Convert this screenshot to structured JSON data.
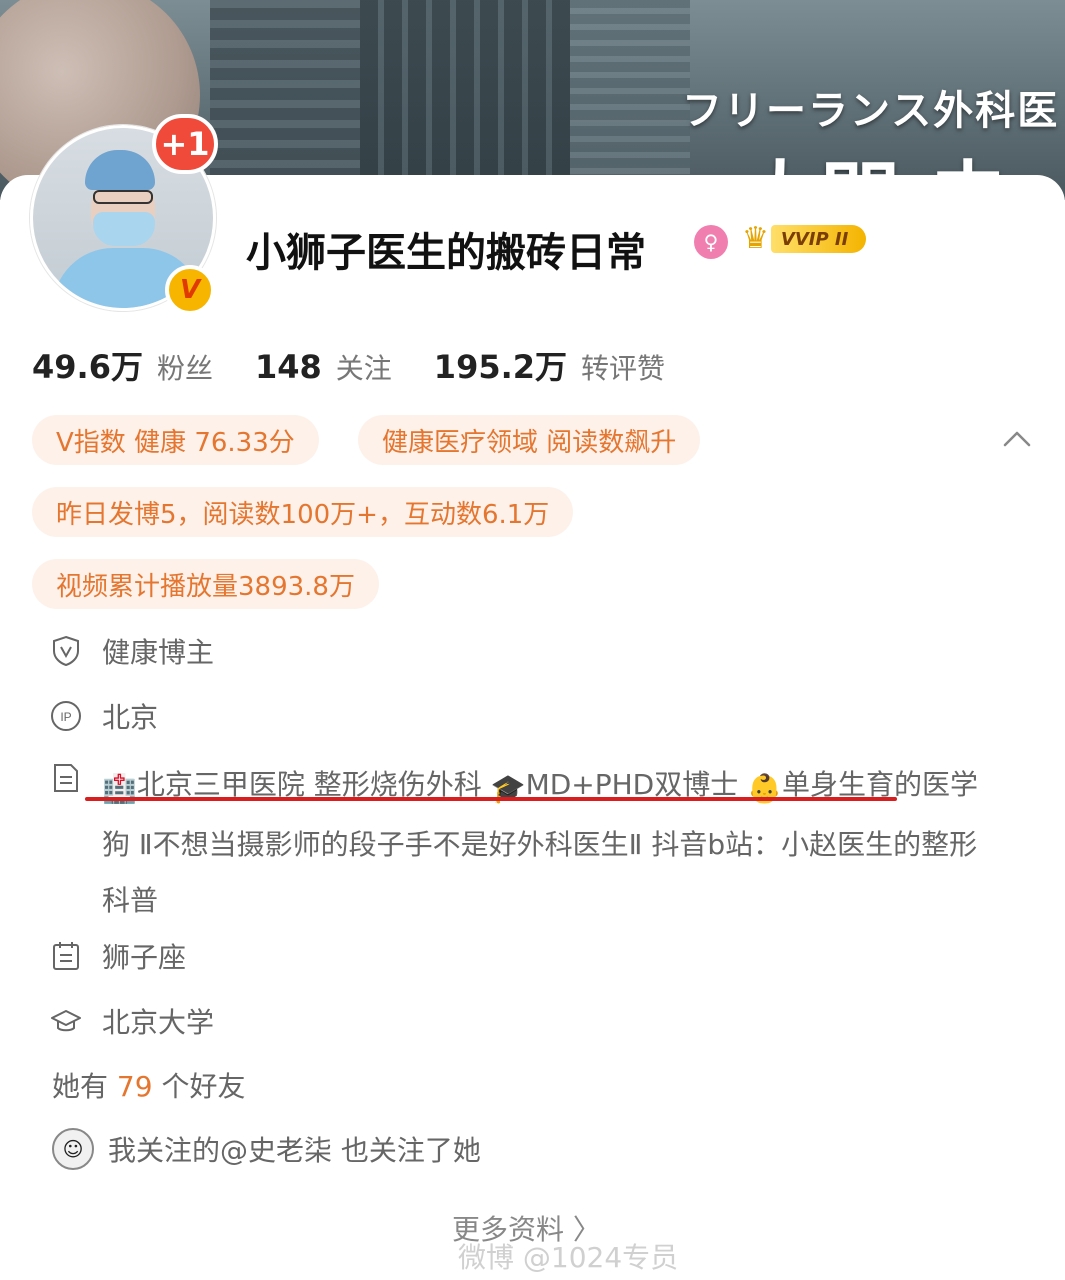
{
  "banner": {
    "jp_text": "フリーランス外科医",
    "big_text": "大門 未"
  },
  "profile": {
    "plus_badge": "+1",
    "verify_badge": "V",
    "name": "小狮子医生的搬砖日常",
    "gender_icon": "female-icon",
    "vip_label": "VVIP II"
  },
  "stats": [
    {
      "num": "49.6万",
      "label": "粉丝"
    },
    {
      "num": "148",
      "label": "关注"
    },
    {
      "num": "195.2万",
      "label": "转评赞"
    }
  ],
  "chips": {
    "v_index": "V指数 健康 76.33分",
    "domain": "健康医疗领域 阅读数飙升",
    "yesterday": "昨日发博5，阅读数100万+，互动数6.1万",
    "video": "视频累计播放量3893.8万"
  },
  "info": {
    "category": "健康博主",
    "ip": "北京",
    "bio_emoji_1": "🏥",
    "bio_part_1": "北京三甲医院 整形烧伤外科  ",
    "bio_emoji_2": "🎓",
    "bio_part_2": "MD+PHD双博士  ",
    "bio_emoji_3": "👶",
    "bio_part_3": "单身生育的医学狗 Ⅱ不想当摄影师的段子手不是好外科医生Ⅱ 抖音b站：小赵医生的整形科普",
    "zodiac": "狮子座",
    "school": "北京大学"
  },
  "friends": {
    "prefix": "她有 ",
    "count": "79",
    "suffix": " 个好友"
  },
  "mutual": {
    "text": "我关注的@史老柒 也关注了她"
  },
  "more_label": "更多资料 〉",
  "watermark": "微博 @1024专员",
  "colors": {
    "accent": "#e5762f",
    "chip_bg": "#fdf1ea",
    "red_underline": "#d81e1e",
    "vip_gold": "#f4b400"
  }
}
